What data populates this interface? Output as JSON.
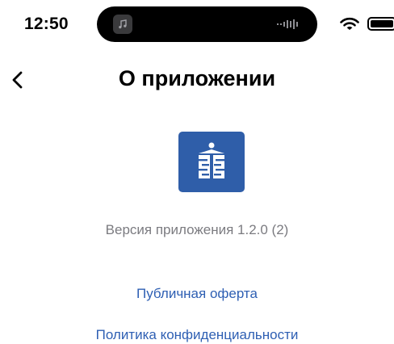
{
  "status_bar": {
    "time": "12:50",
    "icons": [
      "music-note-icon",
      "waveform-icon",
      "wifi-icon",
      "battery-icon"
    ]
  },
  "nav": {
    "back_icon": "chevron-left-icon",
    "title": "О приложении"
  },
  "app": {
    "icon": "app-logo-icon",
    "icon_color": "#2f5ea9",
    "version": "Версия приложения 1.2.0 (2)"
  },
  "links": {
    "offer": "Публичная оферта",
    "privacy": "Политика конфиденциальности",
    "color": "#2e5fb3"
  }
}
